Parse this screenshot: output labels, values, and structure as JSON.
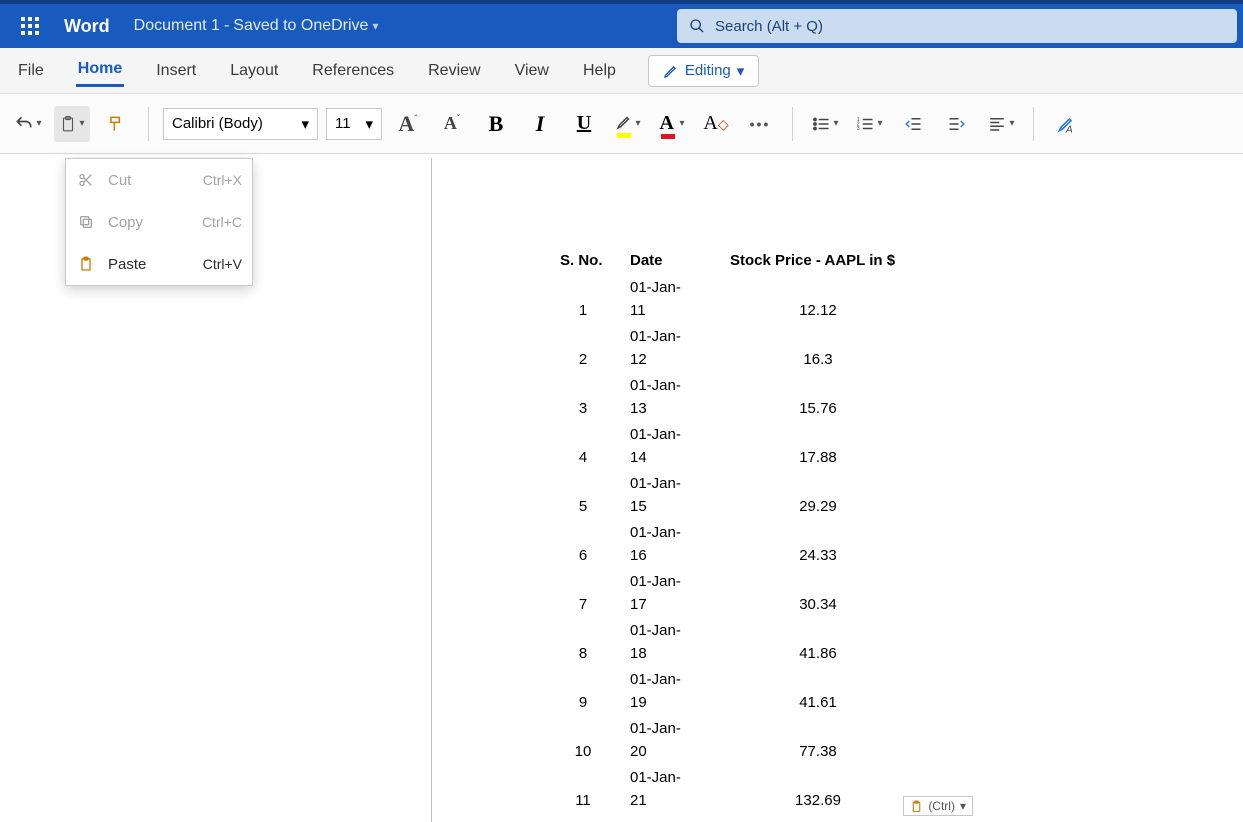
{
  "header": {
    "app_name": "Word",
    "doc_name": "Document 1",
    "saved_status": "Saved to OneDrive",
    "search_placeholder": "Search (Alt + Q)"
  },
  "tabs": {
    "file": "File",
    "home": "Home",
    "insert": "Insert",
    "layout": "Layout",
    "references": "References",
    "review": "Review",
    "view": "View",
    "help": "Help",
    "editing": "Editing"
  },
  "toolbar": {
    "font_name": "Calibri (Body)",
    "font_size": "11"
  },
  "clipboard_menu": {
    "cut_label": "Cut",
    "cut_shortcut": "Ctrl+X",
    "copy_label": "Copy",
    "copy_shortcut": "Ctrl+C",
    "paste_label": "Paste",
    "paste_shortcut": "Ctrl+V"
  },
  "table": {
    "col1": "S. No.",
    "col2": "Date",
    "col3": "Stock Price - AAPL in $",
    "rows": [
      {
        "n": "1",
        "date_a": "01-Jan-",
        "date_b": "11",
        "price": "12.12"
      },
      {
        "n": "2",
        "date_a": "01-Jan-",
        "date_b": "12",
        "price": "16.3"
      },
      {
        "n": "3",
        "date_a": "01-Jan-",
        "date_b": "13",
        "price": "15.76"
      },
      {
        "n": "4",
        "date_a": "01-Jan-",
        "date_b": "14",
        "price": "17.88"
      },
      {
        "n": "5",
        "date_a": "01-Jan-",
        "date_b": "15",
        "price": "29.29"
      },
      {
        "n": "6",
        "date_a": "01-Jan-",
        "date_b": "16",
        "price": "24.33"
      },
      {
        "n": "7",
        "date_a": "01-Jan-",
        "date_b": "17",
        "price": "30.34"
      },
      {
        "n": "8",
        "date_a": "01-Jan-",
        "date_b": "18",
        "price": "41.86"
      },
      {
        "n": "9",
        "date_a": "01-Jan-",
        "date_b": "19",
        "price": "41.61"
      },
      {
        "n": "10",
        "date_a": "01-Jan-",
        "date_b": "20",
        "price": "77.38"
      },
      {
        "n": "11",
        "date_a": "01-Jan-",
        "date_b": "21",
        "price": "132.69"
      }
    ]
  },
  "paste_hint": "(Ctrl)",
  "chart_data": {
    "type": "table",
    "title": "Stock Price - AAPL in $",
    "columns": [
      "S. No.",
      "Date",
      "Stock Price - AAPL in $"
    ],
    "rows": [
      [
        1,
        "01-Jan-11",
        12.12
      ],
      [
        2,
        "01-Jan-12",
        16.3
      ],
      [
        3,
        "01-Jan-13",
        15.76
      ],
      [
        4,
        "01-Jan-14",
        17.88
      ],
      [
        5,
        "01-Jan-15",
        29.29
      ],
      [
        6,
        "01-Jan-16",
        24.33
      ],
      [
        7,
        "01-Jan-17",
        30.34
      ],
      [
        8,
        "01-Jan-18",
        41.86
      ],
      [
        9,
        "01-Jan-19",
        41.61
      ],
      [
        10,
        "01-Jan-20",
        77.38
      ],
      [
        11,
        "01-Jan-21",
        132.69
      ]
    ]
  }
}
